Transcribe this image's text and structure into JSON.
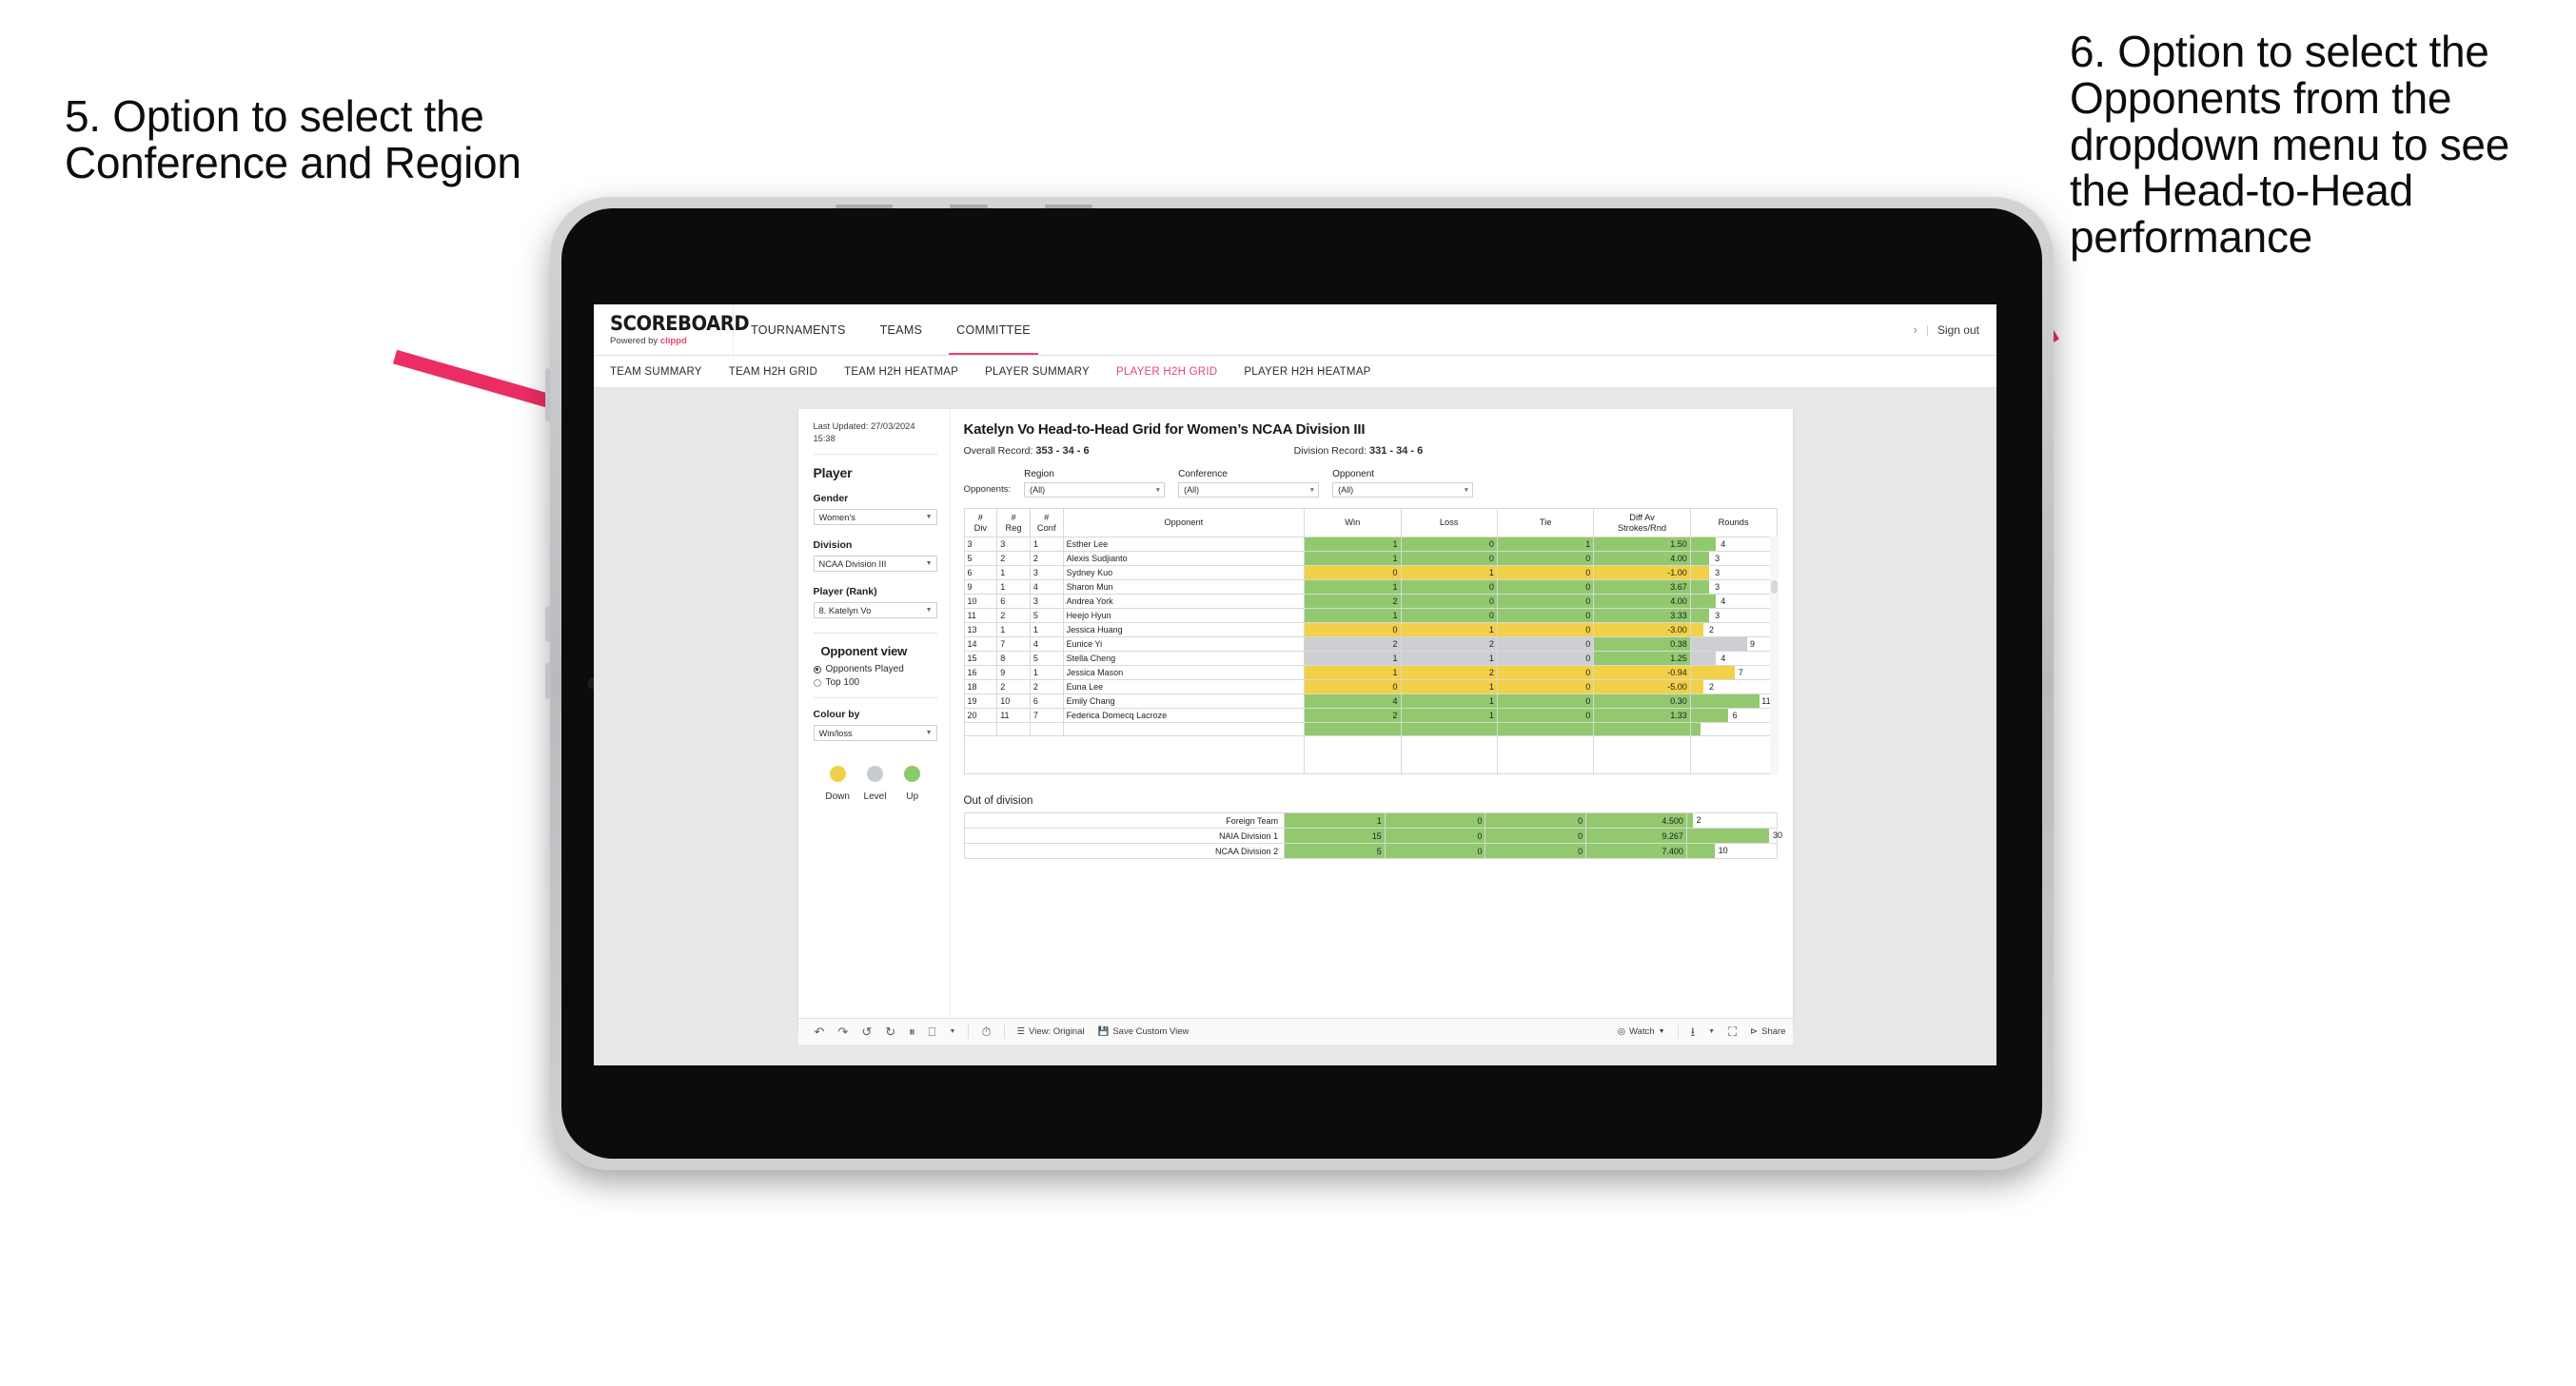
{
  "annotations": {
    "left": "5. Option to select the Conference and Region",
    "right": "6. Option to select the Opponents from the dropdown menu to see the Head-to-Head performance"
  },
  "topbar": {
    "brand_title": "SCOREBOARD",
    "brand_powered": "Powered by ",
    "brand_name": "clippd",
    "nav": [
      {
        "label": "TOURNAMENTS",
        "active": false
      },
      {
        "label": "TEAMS",
        "active": false
      },
      {
        "label": "COMMITTEE",
        "active": true
      }
    ],
    "chevron": "›",
    "separator": "|",
    "sign_out": "Sign out"
  },
  "subnav": [
    {
      "label": "TEAM SUMMARY",
      "active": false
    },
    {
      "label": "TEAM H2H GRID",
      "active": false
    },
    {
      "label": "TEAM H2H HEATMAP",
      "active": false
    },
    {
      "label": "PLAYER SUMMARY",
      "active": false
    },
    {
      "label": "PLAYER H2H GRID",
      "active": true
    },
    {
      "label": "PLAYER H2H HEATMAP",
      "active": false
    }
  ],
  "sidebar": {
    "last_updated": "Last Updated: 27/03/2024 15:38",
    "heading": "Player",
    "fields": [
      {
        "label": "Gender",
        "value": "Women’s"
      },
      {
        "label": "Division",
        "value": "NCAA Division III"
      },
      {
        "label": "Player (Rank)",
        "value": "8. Katelyn Vo"
      }
    ],
    "opponent_view": {
      "heading": "Opponent view",
      "options": [
        {
          "label": "Opponents Played",
          "selected": true
        },
        {
          "label": "Top 100",
          "selected": false
        }
      ]
    },
    "colour_by": {
      "label": "Colour by",
      "value": "Win/loss"
    },
    "legend": [
      {
        "caption": "Down",
        "color": "#f2d047"
      },
      {
        "caption": "Level",
        "color": "#c8cbd0"
      },
      {
        "caption": "Up",
        "color": "#8bc96a"
      }
    ]
  },
  "main": {
    "title": "Katelyn Vo Head-to-Head Grid for Women’s NCAA Division III",
    "overall_record_label": "Overall Record: ",
    "overall_record_value": "353 - 34 - 6",
    "division_record_label": "Division Record: ",
    "division_record_value": "331 -  34 - 6",
    "opponents_label": "Opponents:",
    "filters": [
      {
        "label": "Region",
        "value": "(All)"
      },
      {
        "label": "Conference",
        "value": "(All)"
      },
      {
        "label": "Opponent",
        "value": "(All)"
      }
    ],
    "out_of_division_title": "Out of division"
  },
  "chart_data": {
    "type": "table",
    "title": "Katelyn Vo Head-to-Head Grid for Women’s NCAA Division III",
    "columns": [
      "# Div",
      "# Reg",
      "# Conf",
      "Opponent",
      "Win",
      "Loss",
      "Tie",
      "Diff Av Strokes/Rnd",
      "Rounds"
    ],
    "column_headers_multiline": [
      [
        "#",
        "Div"
      ],
      [
        "#",
        "Reg"
      ],
      [
        "#",
        "Conf"
      ],
      [
        "Opponent"
      ],
      [
        "Win"
      ],
      [
        "Loss"
      ],
      [
        "Tie"
      ],
      [
        "Diff Av",
        "Strokes/Rnd"
      ],
      [
        "Rounds"
      ]
    ],
    "rounds_max": 30,
    "rows": [
      {
        "div": "3",
        "reg": "3",
        "conf": "1",
        "opponent": "Esther Lee",
        "win": "1",
        "loss": "0",
        "tie": "1",
        "diff": "1.50",
        "rounds": "4",
        "color": "g"
      },
      {
        "div": "5",
        "reg": "2",
        "conf": "2",
        "opponent": "Alexis Sudjianto",
        "win": "1",
        "loss": "0",
        "tie": "0",
        "diff": "4.00",
        "rounds": "3",
        "color": "g"
      },
      {
        "div": "6",
        "reg": "1",
        "conf": "3",
        "opponent": "Sydney Kuo",
        "win": "0",
        "loss": "1",
        "tie": "0",
        "diff": "-1.00",
        "rounds": "3",
        "color": "y"
      },
      {
        "div": "9",
        "reg": "1",
        "conf": "4",
        "opponent": "Sharon Mun",
        "win": "1",
        "loss": "0",
        "tie": "0",
        "diff": "3.67",
        "rounds": "3",
        "color": "g"
      },
      {
        "div": "10",
        "reg": "6",
        "conf": "3",
        "opponent": "Andrea York",
        "win": "2",
        "loss": "0",
        "tie": "0",
        "diff": "4.00",
        "rounds": "4",
        "color": "g"
      },
      {
        "div": "11",
        "reg": "2",
        "conf": "5",
        "opponent": "Heejo Hyun",
        "win": "1",
        "loss": "0",
        "tie": "0",
        "diff": "3.33",
        "rounds": "3",
        "color": "g"
      },
      {
        "div": "13",
        "reg": "1",
        "conf": "1",
        "opponent": "Jessica Huang",
        "win": "0",
        "loss": "1",
        "tie": "0",
        "diff": "-3.00",
        "rounds": "2",
        "color": "y"
      },
      {
        "div": "14",
        "reg": "7",
        "conf": "4",
        "opponent": "Eunice Yi",
        "win": "2",
        "loss": "2",
        "tie": "0",
        "diff": "0.38",
        "rounds": "9",
        "color": "gr",
        "diff_color": "g"
      },
      {
        "div": "15",
        "reg": "8",
        "conf": "5",
        "opponent": "Stella Cheng",
        "win": "1",
        "loss": "1",
        "tie": "0",
        "diff": "1.25",
        "rounds": "4",
        "color": "gr",
        "diff_color": "g"
      },
      {
        "div": "16",
        "reg": "9",
        "conf": "1",
        "opponent": "Jessica Mason",
        "win": "1",
        "loss": "2",
        "tie": "0",
        "diff": "-0.94",
        "rounds": "7",
        "color": "y"
      },
      {
        "div": "18",
        "reg": "2",
        "conf": "2",
        "opponent": "Euna Lee",
        "win": "0",
        "loss": "1",
        "tie": "0",
        "diff": "-5.00",
        "rounds": "2",
        "color": "y"
      },
      {
        "div": "19",
        "reg": "10",
        "conf": "6",
        "opponent": "Emily Chang",
        "win": "4",
        "loss": "1",
        "tie": "0",
        "diff": "0.30",
        "rounds": "11",
        "color": "g"
      },
      {
        "div": "20",
        "reg": "11",
        "conf": "7",
        "opponent": "Federica Domecq Lacroze",
        "win": "2",
        "loss": "1",
        "tie": "0",
        "diff": "1.33",
        "rounds": "6",
        "color": "g"
      }
    ],
    "out_of_division": [
      {
        "label": "Foreign Team",
        "win": "1",
        "loss": "0",
        "tie": "0",
        "diff": "4.500",
        "rounds": "2",
        "color": "g"
      },
      {
        "label": "NAIA Division 1",
        "win": "15",
        "loss": "0",
        "tie": "0",
        "diff": "9.267",
        "rounds": "30",
        "color": "g"
      },
      {
        "label": "NCAA Division 2",
        "win": "5",
        "loss": "0",
        "tie": "0",
        "diff": "7.400",
        "rounds": "10",
        "color": "g"
      }
    ]
  },
  "toolbar": {
    "view_label": "View: Original",
    "save_label": "Save Custom View",
    "watch_label": "Watch",
    "share_label": "Share"
  },
  "colors": {
    "accent": "#e8456b",
    "green": "#92c96f",
    "yellow": "#f2d047",
    "grey": "#cdcfd2"
  }
}
